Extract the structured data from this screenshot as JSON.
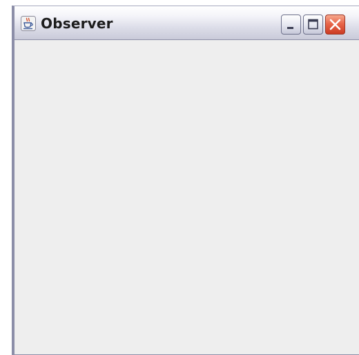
{
  "window": {
    "title": "Observer"
  },
  "titlebar": {
    "app_icon": "java-cup-icon",
    "buttons": {
      "minimize": "minimize-icon",
      "maximize": "maximize-icon",
      "close": "close-icon"
    }
  },
  "colors": {
    "titlebar_gradient_top": "#ffffff",
    "titlebar_gradient_bottom": "#c9cad9",
    "window_border": "#8c8ea8",
    "content_background": "#eeeeee",
    "close_button": "#e8664a"
  }
}
